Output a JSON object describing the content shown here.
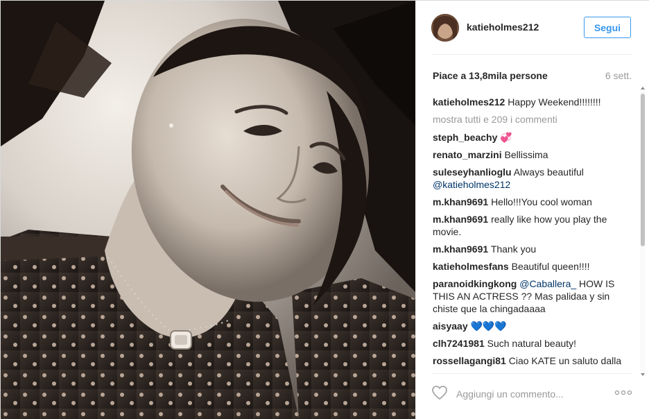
{
  "post": {
    "username": "katieholmes212",
    "follow_label": "Segui",
    "likes": "Piace a 13,8mila persone",
    "time": "6 sett.",
    "caption_user": "katieholmes212",
    "caption_text": "Happy Weekend!!!!!!!!",
    "load_more": "mostra tutti e 209 i commenti",
    "comment_placeholder": "Aggiungi un commento..."
  },
  "comments": [
    {
      "user": "steph_beachy",
      "text": "💞"
    },
    {
      "user": "renato_marzini",
      "text": "Bellissima"
    },
    {
      "user": "suleseyhanlioglu",
      "text": "Always beautiful",
      "mention": "@katieholmes212"
    },
    {
      "user": "m.khan9691",
      "text": "Hello!!!You cool woman"
    },
    {
      "user": "m.khan9691",
      "text": "really like how you play the movie."
    },
    {
      "user": "m.khan9691",
      "text": "Thank you"
    },
    {
      "user": "katieholmesfans",
      "text": "Beautiful queen!!!!"
    },
    {
      "user": "paranoidkingkong",
      "mention": "@Caballera_",
      "text": "HOW IS THIS AN ACTRESS ?? Mas palidaa y sin chiste que la chingadaaaa"
    },
    {
      "user": "aisyaay",
      "text": "💙💙💙"
    },
    {
      "user": "clh7241981",
      "text": "Such natural beauty!"
    },
    {
      "user": "rossellagangi81",
      "text": "Ciao KATE un saluto dalla Calabria!!!"
    }
  ],
  "icons": {
    "heart": "heart-icon",
    "more": "more-options-icon",
    "avatar": "avatar-icon"
  },
  "colors": {
    "accent": "#3897f0",
    "mention": "#003569",
    "muted": "#999999",
    "text": "#262626"
  }
}
